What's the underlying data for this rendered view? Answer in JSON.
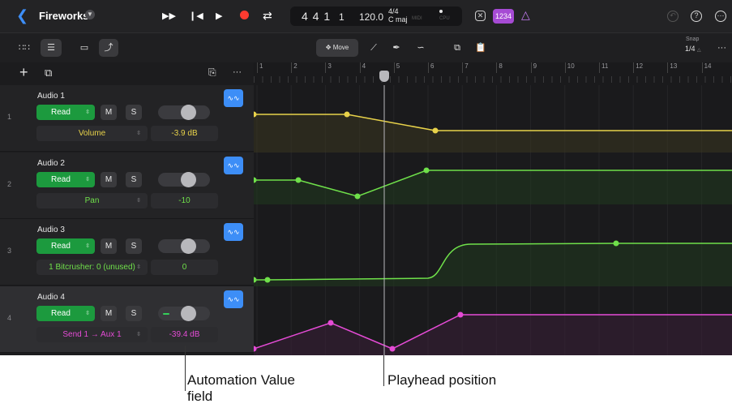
{
  "app": {
    "project_title": "Fireworks",
    "colors": {
      "accent_blue": "#3d8ef7",
      "read_green": "#1c9a3e",
      "record_red": "#ff3b30",
      "purple": "#a64bd4"
    }
  },
  "control_bar": {
    "back_icon": "chevron-left-icon",
    "transport": [
      "fast-forward-icon",
      "go-to-start-icon",
      "play-icon",
      "record-icon",
      "cycle-icon"
    ],
    "lcd": {
      "position": "4 4 1",
      "position_tick": "1",
      "tempo": "120.0",
      "time_signature": "4/4",
      "key": "C maj",
      "midi_label": "MIDI",
      "cpu_label": "CPU"
    },
    "count_in_label": "1234"
  },
  "toolbar": {
    "move_label": "Move",
    "snap_label": "Snap",
    "snap_value": "1/4"
  },
  "ruler": {
    "bars": [
      "1",
      "2",
      "3",
      "4",
      "5",
      "6",
      "7",
      "8",
      "9",
      "10",
      "11",
      "12",
      "13",
      "14"
    ]
  },
  "tracks": [
    {
      "number": "1",
      "name": "Audio 1",
      "mode": "Read",
      "mute": "M",
      "solo": "S",
      "parameter": "Volume",
      "value": "-3.9 dB",
      "color": "#e8d24a"
    },
    {
      "number": "2",
      "name": "Audio 2",
      "mode": "Read",
      "mute": "M",
      "solo": "S",
      "parameter": "Pan",
      "value": "-10",
      "color": "#6fe04a"
    },
    {
      "number": "3",
      "name": "Audio 3",
      "mode": "Read",
      "mute": "M",
      "solo": "S",
      "parameter": "1 Bitcrusher: 0 (unused)",
      "value": "0",
      "color": "#6fe04a"
    },
    {
      "number": "4",
      "name": "Audio 4",
      "mode": "Read",
      "mute": "M",
      "solo": "S",
      "parameter": "Send 1 → Aux 1",
      "value": "-39.4 dB",
      "color": "#e54bd6"
    }
  ],
  "callouts": {
    "automation_value_field_line1": "Automation Value",
    "automation_value_field_line2": "field",
    "playhead_position": "Playhead position"
  }
}
